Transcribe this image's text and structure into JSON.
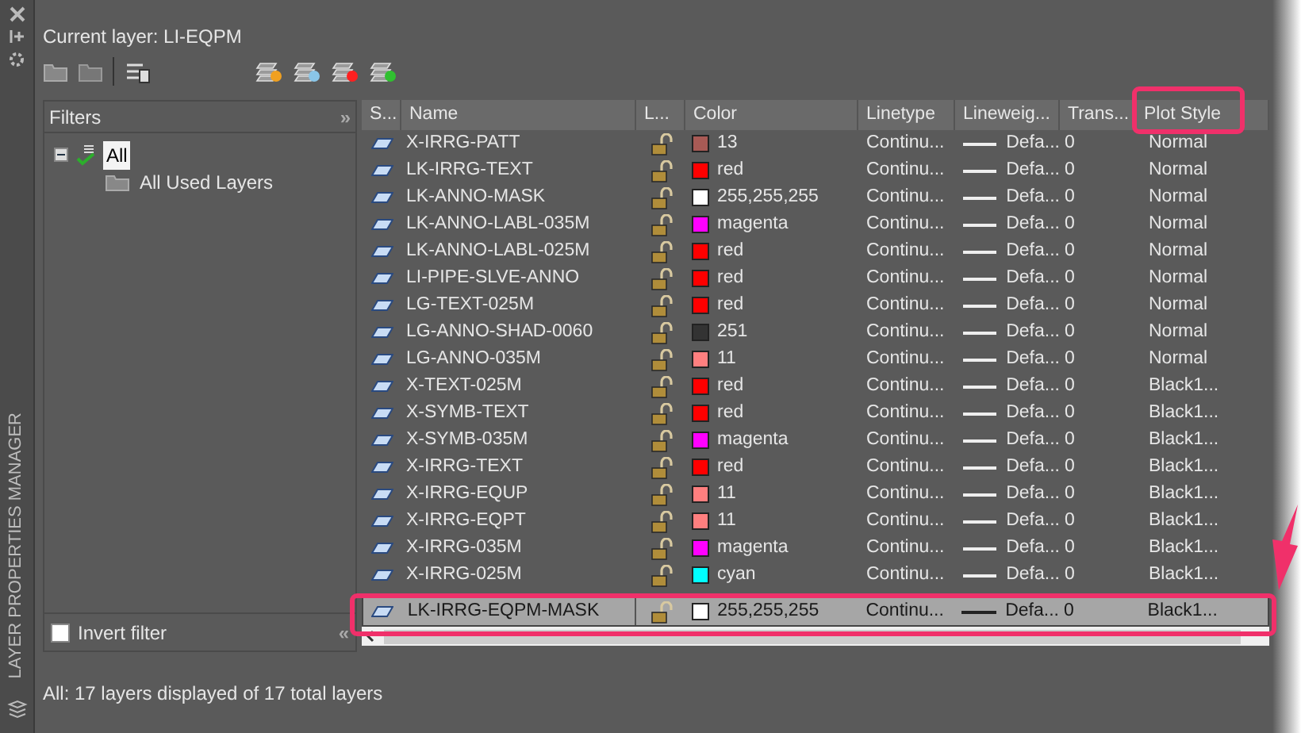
{
  "palette": {
    "title": "LAYER PROPERTIES MANAGER"
  },
  "current_layer": "Current layer: LI-EQPM",
  "filters": {
    "title": "Filters",
    "expand_button": "»",
    "collapse_button": "«",
    "tree": [
      {
        "label": "All",
        "selected": true,
        "expanded": true,
        "children": [
          {
            "label": "All Used Layers",
            "selected": false
          }
        ]
      }
    ],
    "invert_filter": {
      "label": "Invert filter",
      "checked": false
    }
  },
  "table": {
    "columns": [
      "S...",
      "Name",
      "L...",
      "Color",
      "Linetype",
      "Lineweig...",
      "Trans...",
      "Plot Style"
    ],
    "rows": [
      {
        "name": "X-IRRG-PATT",
        "locked": false,
        "color": "#a85a55",
        "color_name": "13",
        "linetype": "Continu...",
        "lineweight": "Defa...",
        "transparency": "0",
        "plot_style": "Normal",
        "selected": false
      },
      {
        "name": "LK-IRRG-TEXT",
        "locked": false,
        "color": "#ff0000",
        "color_name": "red",
        "linetype": "Continu...",
        "lineweight": "Defa...",
        "transparency": "0",
        "plot_style": "Normal",
        "selected": false
      },
      {
        "name": "LK-ANNO-MASK",
        "locked": false,
        "color": "#ffffff",
        "color_name": "255,255,255",
        "linetype": "Continu...",
        "lineweight": "Defa...",
        "transparency": "0",
        "plot_style": "Normal",
        "selected": false
      },
      {
        "name": "LK-ANNO-LABL-035M",
        "locked": false,
        "color": "#ff00ff",
        "color_name": "magenta",
        "linetype": "Continu...",
        "lineweight": "Defa...",
        "transparency": "0",
        "plot_style": "Normal",
        "selected": false
      },
      {
        "name": "LK-ANNO-LABL-025M",
        "locked": false,
        "color": "#ff0000",
        "color_name": "red",
        "linetype": "Continu...",
        "lineweight": "Defa...",
        "transparency": "0",
        "plot_style": "Normal",
        "selected": false
      },
      {
        "name": "LI-PIPE-SLVE-ANNO",
        "locked": false,
        "color": "#ff0000",
        "color_name": "red",
        "linetype": "Continu...",
        "lineweight": "Defa...",
        "transparency": "0",
        "plot_style": "Normal",
        "selected": false
      },
      {
        "name": "LG-TEXT-025M",
        "locked": false,
        "color": "#ff0000",
        "color_name": "red",
        "linetype": "Continu...",
        "lineweight": "Defa...",
        "transparency": "0",
        "plot_style": "Normal",
        "selected": false
      },
      {
        "name": "LG-ANNO-SHAD-0060",
        "locked": false,
        "color": "#333333",
        "color_name": "251",
        "linetype": "Continu...",
        "lineweight": "Defa...",
        "transparency": "0",
        "plot_style": "Normal",
        "selected": false
      },
      {
        "name": "LG-ANNO-035M",
        "locked": false,
        "color": "#ff7f7f",
        "color_name": "11",
        "linetype": "Continu...",
        "lineweight": "Defa...",
        "transparency": "0",
        "plot_style": "Normal",
        "selected": false
      },
      {
        "name": "X-TEXT-025M",
        "locked": false,
        "color": "#ff0000",
        "color_name": "red",
        "linetype": "Continu...",
        "lineweight": "Defa...",
        "transparency": "0",
        "plot_style": "Black1...",
        "selected": false
      },
      {
        "name": "X-SYMB-TEXT",
        "locked": false,
        "color": "#ff0000",
        "color_name": "red",
        "linetype": "Continu...",
        "lineweight": "Defa...",
        "transparency": "0",
        "plot_style": "Black1...",
        "selected": false
      },
      {
        "name": "X-SYMB-035M",
        "locked": false,
        "color": "#ff00ff",
        "color_name": "magenta",
        "linetype": "Continu...",
        "lineweight": "Defa...",
        "transparency": "0",
        "plot_style": "Black1...",
        "selected": false
      },
      {
        "name": "X-IRRG-TEXT",
        "locked": false,
        "color": "#ff0000",
        "color_name": "red",
        "linetype": "Continu...",
        "lineweight": "Defa...",
        "transparency": "0",
        "plot_style": "Black1...",
        "selected": false
      },
      {
        "name": "X-IRRG-EQUP",
        "locked": false,
        "color": "#ff7f7f",
        "color_name": "11",
        "linetype": "Continu...",
        "lineweight": "Defa...",
        "transparency": "0",
        "plot_style": "Black1...",
        "selected": false
      },
      {
        "name": "X-IRRG-EQPT",
        "locked": false,
        "color": "#ff7f7f",
        "color_name": "11",
        "linetype": "Continu...",
        "lineweight": "Defa...",
        "transparency": "0",
        "plot_style": "Black1...",
        "selected": false
      },
      {
        "name": "X-IRRG-035M",
        "locked": false,
        "color": "#ff00ff",
        "color_name": "magenta",
        "linetype": "Continu...",
        "lineweight": "Defa...",
        "transparency": "0",
        "plot_style": "Black1...",
        "selected": false
      },
      {
        "name": "X-IRRG-025M",
        "locked": false,
        "color": "#00ffff",
        "color_name": "cyan",
        "linetype": "Continu...",
        "lineweight": "Defa...",
        "transparency": "0",
        "plot_style": "Black1...",
        "selected": false
      },
      {
        "name": "LK-IRRG-EQPM-MASK",
        "locked": false,
        "color": "#ffffff",
        "color_name": "255,255,255",
        "linetype": "Continu...",
        "lineweight": "Defa...",
        "transparency": "0",
        "plot_style": "Black1...",
        "selected": true
      }
    ]
  },
  "status_bar": "All: 17 layers displayed of 17 total layers"
}
